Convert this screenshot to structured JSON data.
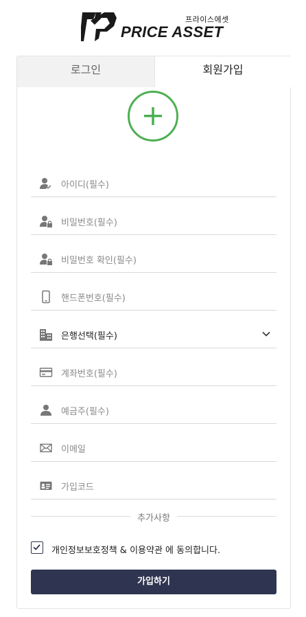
{
  "brand": {
    "sub_label": "프라이스에셋",
    "name": "PRICE ASSET",
    "accent_color": "#1a1a1a"
  },
  "tabs": {
    "login": "로그인",
    "signup": "회원가입",
    "active": "signup"
  },
  "avatar_icon": "plus-circle-icon",
  "fields": [
    {
      "placeholder": "아이디(필수)",
      "icon": "user-check-icon"
    },
    {
      "placeholder": "비밀번호(필수)",
      "icon": "user-lock-icon"
    },
    {
      "placeholder": "비밀번호 확인(필수)",
      "icon": "user-lock-icon"
    },
    {
      "placeholder": "핸드폰번호(필수)",
      "icon": "mobile-phone-icon"
    },
    {
      "placeholder": "은행선택(필수)",
      "icon": "bank-building-icon"
    },
    {
      "placeholder": "계좌번호(필수)",
      "icon": "credit-card-icon"
    },
    {
      "placeholder": "예금주(필수)",
      "icon": "user-icon"
    },
    {
      "placeholder": "이메일",
      "icon": "envelope-icon"
    },
    {
      "placeholder": "가입코드",
      "icon": "id-card-icon"
    }
  ],
  "extra_section": "추가사항",
  "agreement": {
    "text": "개인정보보호정책 & 이용약관 에 동의합니다.",
    "checked": true
  },
  "submit_label": "가입하기",
  "colors": {
    "primary_button": "#2f3550",
    "add_icon": "#4caf50",
    "inactive_tab": "#f2f2f2"
  }
}
